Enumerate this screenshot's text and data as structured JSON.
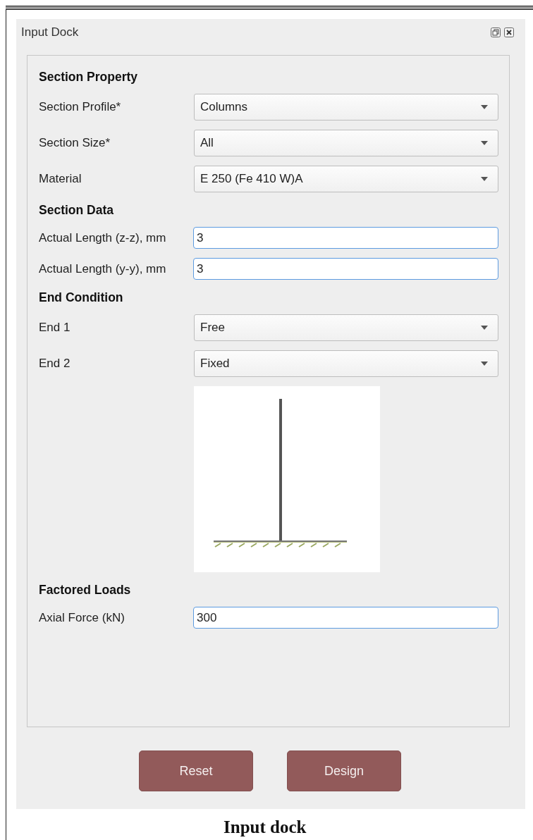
{
  "dock": {
    "title": "Input Dock"
  },
  "sections": [
    {
      "heading": "Section Property",
      "rows": [
        {
          "kind": "combo",
          "label": "Section Profile*",
          "value": "Columns"
        },
        {
          "kind": "combo",
          "label": "Section Size*",
          "value": "All"
        },
        {
          "kind": "combo",
          "label": "Material",
          "value": "E 250 (Fe 410 W)A"
        }
      ]
    },
    {
      "heading": "Section Data",
      "rows": [
        {
          "kind": "text",
          "label": "Actual Length (z-z), mm",
          "value": "3"
        },
        {
          "kind": "text",
          "label": "Actual Length (y-y), mm",
          "value": "3"
        }
      ]
    },
    {
      "heading": "End Condition",
      "rows": [
        {
          "kind": "combo",
          "label": "End 1",
          "value": "Free"
        },
        {
          "kind": "combo",
          "label": "End 2",
          "value": "Fixed"
        },
        {
          "kind": "image"
        }
      ]
    },
    {
      "heading": "Factored Loads",
      "rows": [
        {
          "kind": "text",
          "label": "Axial Force (kN)",
          "value": "300"
        }
      ]
    }
  ],
  "buttons": [
    "Reset",
    "Design"
  ],
  "caption": "Input dock"
}
